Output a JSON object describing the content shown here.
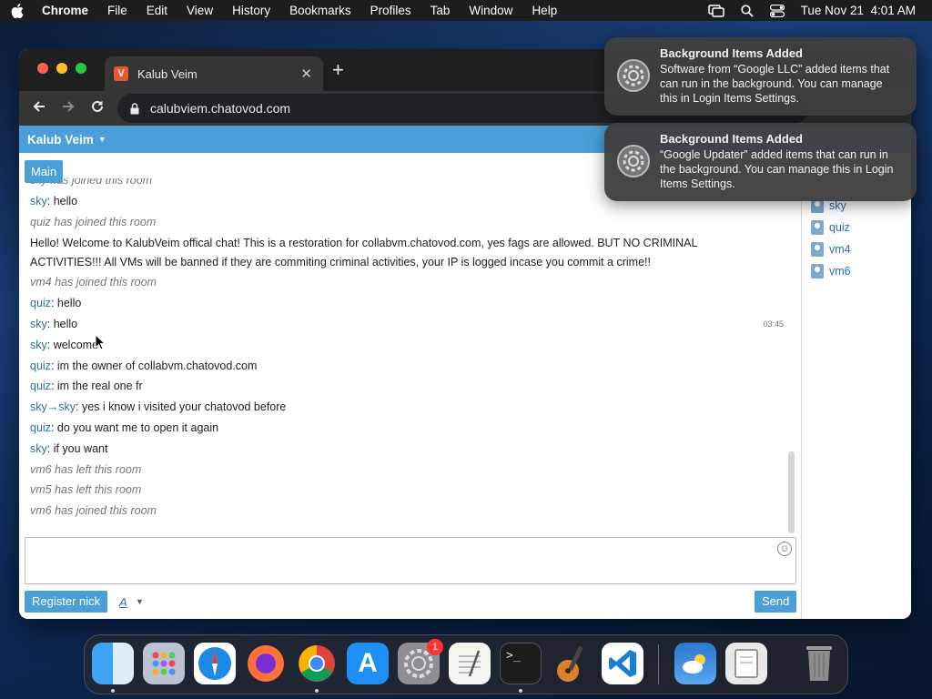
{
  "menubar": {
    "items": [
      "Chrome",
      "File",
      "Edit",
      "View",
      "History",
      "Bookmarks",
      "Profiles",
      "Tab",
      "Window",
      "Help"
    ],
    "datetime": "Tue Nov 21  4:01 AM"
  },
  "browser": {
    "tab_title": "Kalub Veim",
    "url": "calubviem.chatovod.com"
  },
  "chat": {
    "header_name": "Kalub Veim",
    "room_tab": "Main",
    "messages": [
      {
        "type": "system",
        "text": "sky has joined this room"
      },
      {
        "type": "chat",
        "nick": "sky",
        "text": ": hello"
      },
      {
        "type": "system",
        "text": "quiz has joined this room"
      },
      {
        "type": "plain",
        "text": "Hello! Welcome to KalubVeim offical chat! This is a restoration for collabvm.chatovod.com, yes fags are allowed. BUT NO CRIMINAL ACTIVITIES!!! All VMs will be banned if they are commiting criminal activities, your IP is logged incase you commit a crime!!"
      },
      {
        "type": "system",
        "text": "vm4 has joined this room"
      },
      {
        "type": "chat",
        "nick": "quiz",
        "text": ": hello"
      },
      {
        "type": "chat",
        "nick": "sky",
        "text": ": hello",
        "time": "03:45"
      },
      {
        "type": "chat",
        "nick": "sky",
        "text": ": welcome"
      },
      {
        "type": "chat",
        "nick": "quiz",
        "text": ": im the owner of collabvm.chatovod.com"
      },
      {
        "type": "chat",
        "nick": "quiz",
        "text": ": im the real one fr"
      },
      {
        "type": "chat",
        "nick": "sky→sky",
        "text": ": yes i know i visited your chatovod before"
      },
      {
        "type": "chat",
        "nick": "quiz",
        "text": ": do you want me to open it again"
      },
      {
        "type": "chat",
        "nick": "sky",
        "text": ": if you want"
      },
      {
        "type": "system",
        "text": "vm6 has left this room"
      },
      {
        "type": "system",
        "text": "vm5 has left this room"
      },
      {
        "type": "system",
        "text": "vm6 has joined this room"
      }
    ],
    "users": [
      "sky",
      "quiz",
      "vm4",
      "vm6"
    ],
    "register_label": "Register nick",
    "font_label": "A",
    "send_label": "Send"
  },
  "notifications": [
    {
      "title": "Background Items Added",
      "body": "Software from “Google LLC” added items that can run in the background. You can manage this in Login Items Settings."
    },
    {
      "title": "Background Items Added",
      "body": "“Google Updater” added items that can run in the background. You can manage this in Login Items Settings."
    }
  ],
  "dock": {
    "apps": [
      "finder",
      "launchpad",
      "safari",
      "firefox",
      "chrome",
      "app-store",
      "system-settings",
      "textedit",
      "terminal",
      "garageband",
      "vscode",
      "weather",
      "preview",
      "trash"
    ],
    "settings_badge": "1"
  },
  "colors": {
    "accent": "#4a9fd8",
    "nick": "#2a6fb3",
    "system_text": "#777777"
  }
}
